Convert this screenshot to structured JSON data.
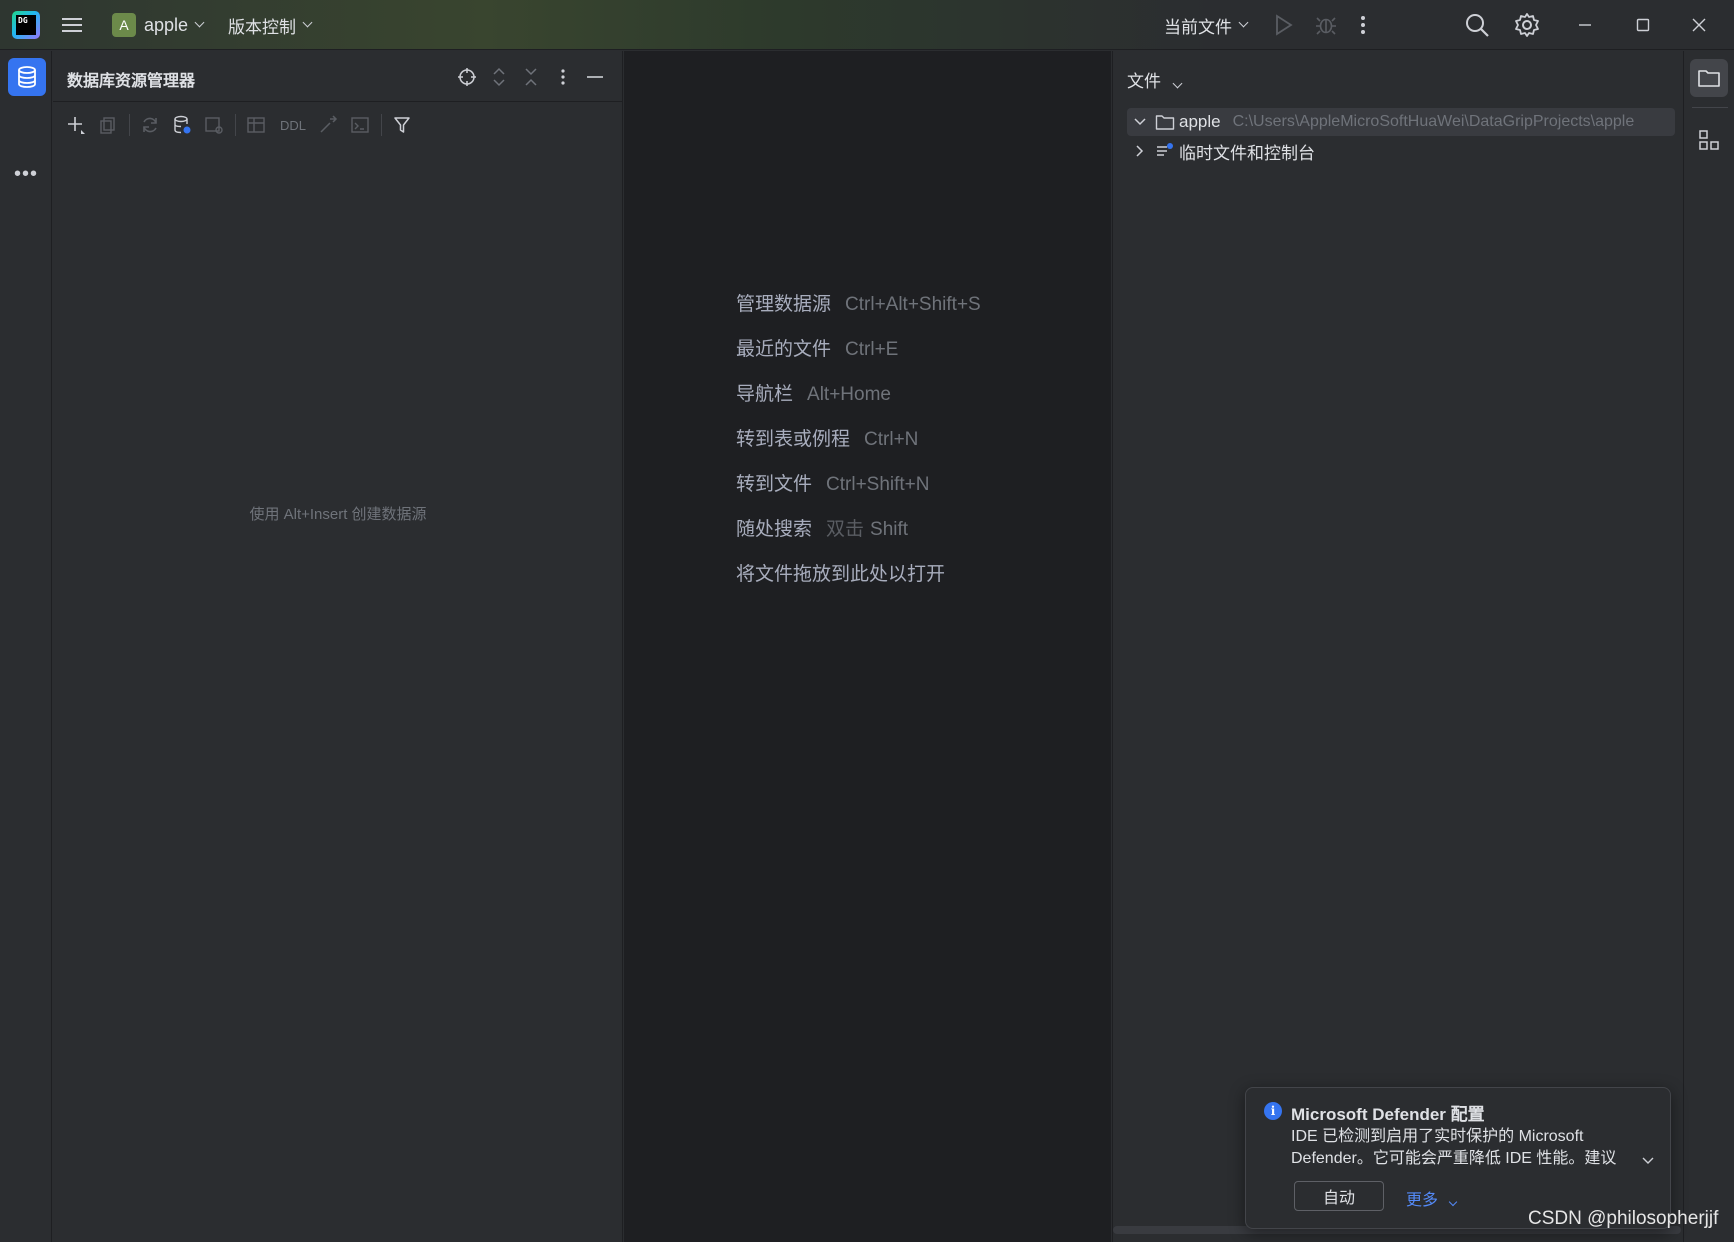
{
  "titlebar": {
    "logo_text": "DG",
    "project_badge": "A",
    "project_name": "apple",
    "vcs_label": "版本控制",
    "run_config": "当前文件"
  },
  "db_explorer": {
    "title": "数据库资源管理器",
    "toolbar_ddl": "DDL",
    "empty_hint": "使用 Alt+Insert 创建数据源"
  },
  "editor_hints": [
    {
      "action": "管理数据源",
      "shortcut": "Ctrl+Alt+Shift+S"
    },
    {
      "action": "最近的文件",
      "shortcut": "Ctrl+E"
    },
    {
      "action": "导航栏",
      "shortcut": "Alt+Home"
    },
    {
      "action": "转到表或例程",
      "shortcut": "Ctrl+N"
    },
    {
      "action": "转到文件",
      "shortcut": "Ctrl+Shift+N"
    },
    {
      "action": "随处搜索",
      "shortcut_prefix": "双击",
      "shortcut": "Shift"
    },
    {
      "action": "将文件拖放到此处以打开",
      "shortcut": ""
    }
  ],
  "files_panel": {
    "title": "文件",
    "tree": [
      {
        "label": "apple",
        "path": "C:\\Users\\AppleMicroSoftHuaWei\\DataGripProjects\\apple"
      },
      {
        "label": "临时文件和控制台",
        "path": ""
      }
    ]
  },
  "notification": {
    "title": "Microsoft Defender 配置",
    "body": "IDE 已检测到启用了实时保护的 Microsoft Defender。它可能会严重降低 IDE 性能。建议",
    "button": "自动",
    "more": "更多"
  },
  "watermark": "CSDN @philosopherjjf",
  "colors": {
    "accent": "#3574f0",
    "link": "#548af7",
    "background": "#2b2d30",
    "editor_bg": "#1e1f22"
  }
}
